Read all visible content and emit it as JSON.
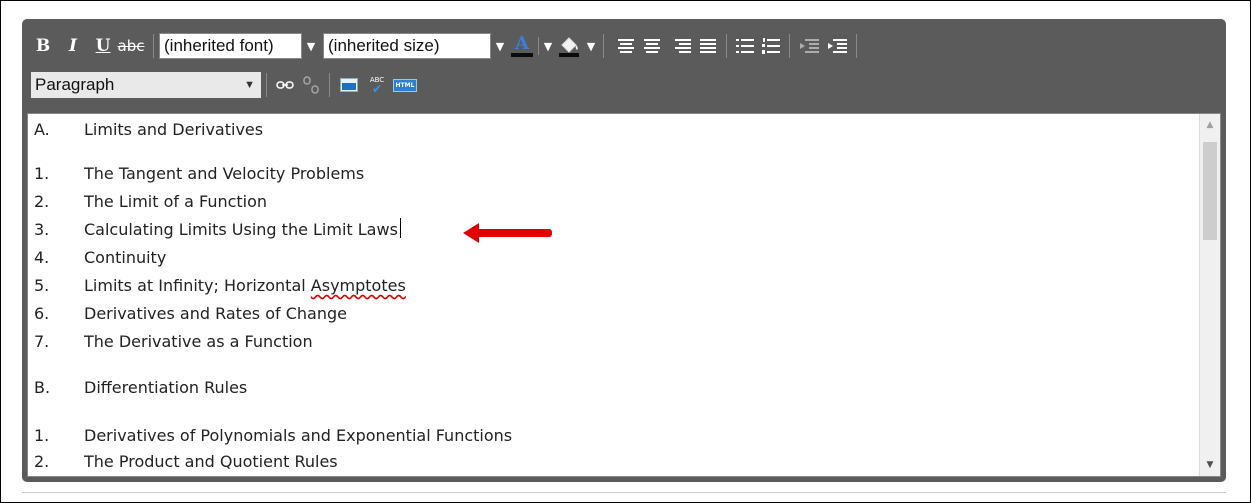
{
  "toolbar": {
    "bold_label": "B",
    "italic_label": "I",
    "underline_label": "U",
    "strike_label": "abc",
    "font_select": "(inherited font)",
    "size_select": "(inherited size)",
    "text_color_label": "A",
    "format_select": "Paragraph",
    "spellcheck_label": "ABC",
    "html_label": "HTML"
  },
  "content": {
    "lines": [
      {
        "num": "A.",
        "text": "Limits and Derivatives"
      },
      {
        "num": "1.",
        "text": "The Tangent and Velocity Problems"
      },
      {
        "num": "2.",
        "text": "The Limit of a Function"
      },
      {
        "num": "3.",
        "text": "Calculating Limits Using the Limit Laws"
      },
      {
        "num": "4.",
        "text": "Continuity"
      },
      {
        "num": "5.",
        "text_before": "Limits at Infinity; Horizontal ",
        "text_misspelled": "Asymptotes"
      },
      {
        "num": "6.",
        "text": "Derivatives and Rates of Change"
      },
      {
        "num": "7.",
        "text": "The Derivative as a Function"
      },
      {
        "num": "B.",
        "text": "Differentiation Rules"
      },
      {
        "num": "1.",
        "text": "Derivatives of Polynomials and Exponential Functions"
      },
      {
        "num": "2.",
        "text": "The Product and Quotient Rules"
      }
    ]
  },
  "colors": {
    "toolbar_bg": "#5b5b5b",
    "text_color_underline": "#0b0b0b",
    "text_color_glyph": "#3b7fd6",
    "annotation_arrow": "#e00000",
    "spelling_underline": "#d00000"
  }
}
